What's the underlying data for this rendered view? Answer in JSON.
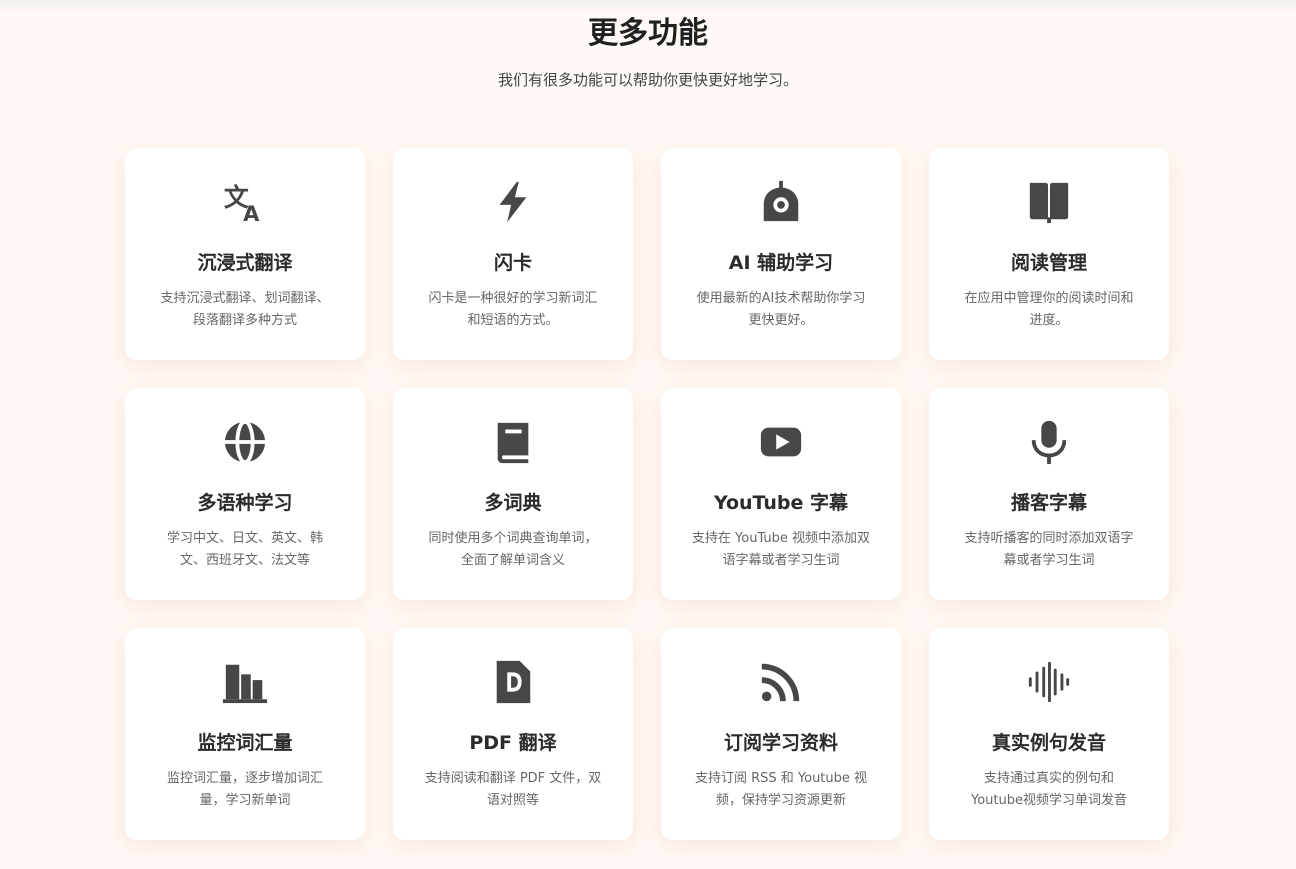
{
  "section": {
    "title": "更多功能",
    "subtitle": "我们有很多功能可以帮助你更快更好地学习。"
  },
  "colors": {
    "background": "#fff8f4",
    "card": "#ffffff",
    "icon": "#474747"
  },
  "features": [
    {
      "icon": "translate-icon",
      "title": "沉浸式翻译",
      "desc": "支持沉浸式翻译、划词翻译、段落翻译多种方式"
    },
    {
      "icon": "lightning-icon",
      "title": "闪卡",
      "desc": "闪卡是一种很好的学习新词汇和短语的方式。"
    },
    {
      "icon": "robot-icon",
      "title": "AI 辅助学习",
      "desc": "使用最新的AI技术帮助你学习更快更好。"
    },
    {
      "icon": "book-open-icon",
      "title": "阅读管理",
      "desc": "在应用中管理你的阅读时间和进度。"
    },
    {
      "icon": "globe-icon",
      "title": "多语种学习",
      "desc": "学习中文、日文、英文、韩文、西班牙文、法文等"
    },
    {
      "icon": "dictionary-icon",
      "title": "多词典",
      "desc": "同时使用多个词典查询单词，全面了解单词含义"
    },
    {
      "icon": "youtube-icon",
      "title": "YouTube 字幕",
      "desc": "支持在 YouTube 视频中添加双语字幕或者学习生词"
    },
    {
      "icon": "microphone-icon",
      "title": "播客字幕",
      "desc": "支持听播客的同时添加双语字幕或者学习生词"
    },
    {
      "icon": "bar-chart-icon",
      "title": "监控词汇量",
      "desc": "监控词汇量，逐步增加词汇量，学习新单词"
    },
    {
      "icon": "pdf-file-icon",
      "title": "PDF 翻译",
      "desc": "支持阅读和翻译 PDF 文件，双语对照等"
    },
    {
      "icon": "rss-icon",
      "title": "订阅学习资料",
      "desc": "支持订阅 RSS 和 Youtube 视频，保持学习资源更新"
    },
    {
      "icon": "sound-wave-icon",
      "title": "真实例句发音",
      "desc": "支持通过真实的例句和Youtube视频学习单词发音"
    }
  ]
}
